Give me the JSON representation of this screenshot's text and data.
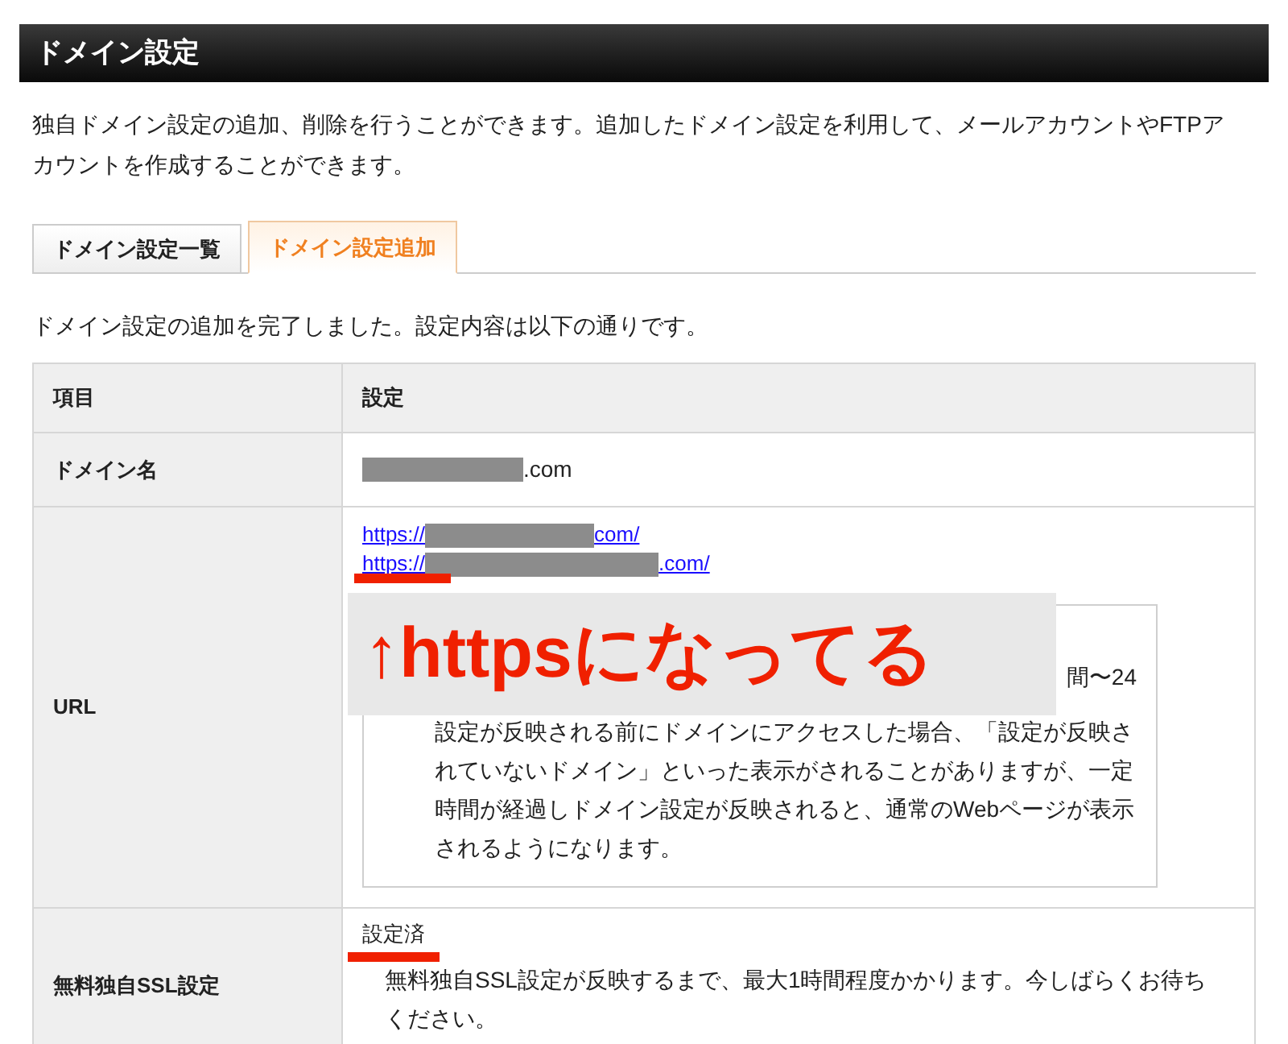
{
  "header": {
    "title": "ドメイン設定"
  },
  "description": "独自ドメイン設定の追加、削除を行うことができます。追加したドメイン設定を利用して、メールアカウントやFTPアカウントを作成することができます。",
  "tabs": [
    {
      "label": "ドメイン設定一覧",
      "selected": false
    },
    {
      "label": "ドメイン設定追加",
      "selected": true
    }
  ],
  "message": "ドメイン設定の追加を完了しました。設定内容は以下の通りです。",
  "table": {
    "columns": [
      "項目",
      "設定"
    ],
    "rows": [
      {
        "kind": "domain",
        "label": "ドメイン名",
        "suffix": ".com"
      },
      {
        "kind": "urls",
        "label": "URL",
        "links": [
          {
            "prefix": "https://",
            "suffix": "com/"
          },
          {
            "prefix": "https://",
            "suffix": ".com/"
          }
        ],
        "note_fragment": "間〜24",
        "note": "設定が反映される前にドメインにアクセスした場合、「設定が反映されていないドメイン」といった表示がされることがありますが、一定時間が経過しドメイン設定が反映されると、通常のWebページが表示されるようになります。"
      },
      {
        "kind": "ssl",
        "label": "無料独自SSL設定",
        "status": "設定済",
        "note": "無料独自SSL設定が反映するまで、最大1時間程度かかります。今しばらくお待ちください。"
      }
    ]
  },
  "annotation": {
    "text": "↑httpsになってる"
  }
}
